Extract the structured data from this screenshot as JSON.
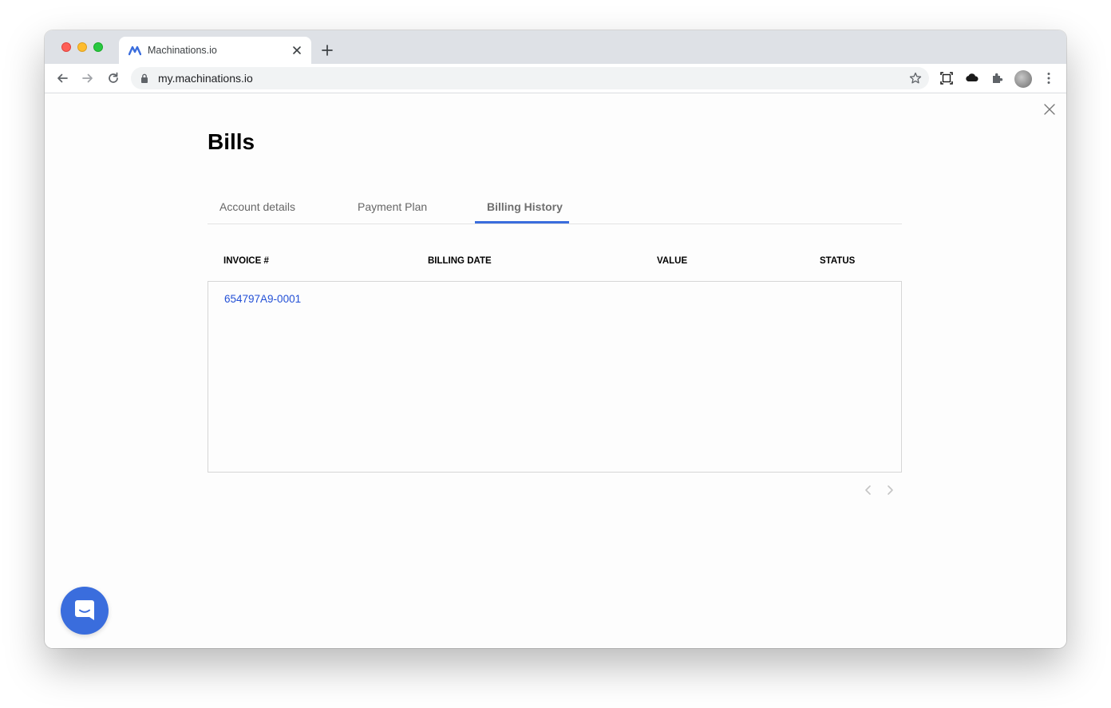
{
  "browser": {
    "tab_title": "Machinations.io",
    "url": "my.machinations.io"
  },
  "page": {
    "title": "Bills",
    "tabs": [
      {
        "label": "Account details",
        "active": false
      },
      {
        "label": "Payment Plan",
        "active": false
      },
      {
        "label": "Billing History",
        "active": true
      }
    ],
    "table": {
      "columns": [
        "INVOICE #",
        "BILLING DATE",
        "VALUE",
        "STATUS"
      ],
      "rows": [
        {
          "invoice": "654797A9-0001",
          "billing_date": "",
          "value": "",
          "status": ""
        }
      ]
    }
  },
  "colors": {
    "accent": "#3a6ddd",
    "link": "#2350d6"
  },
  "icons": {
    "chat": "chat-icon",
    "close": "close-icon"
  }
}
